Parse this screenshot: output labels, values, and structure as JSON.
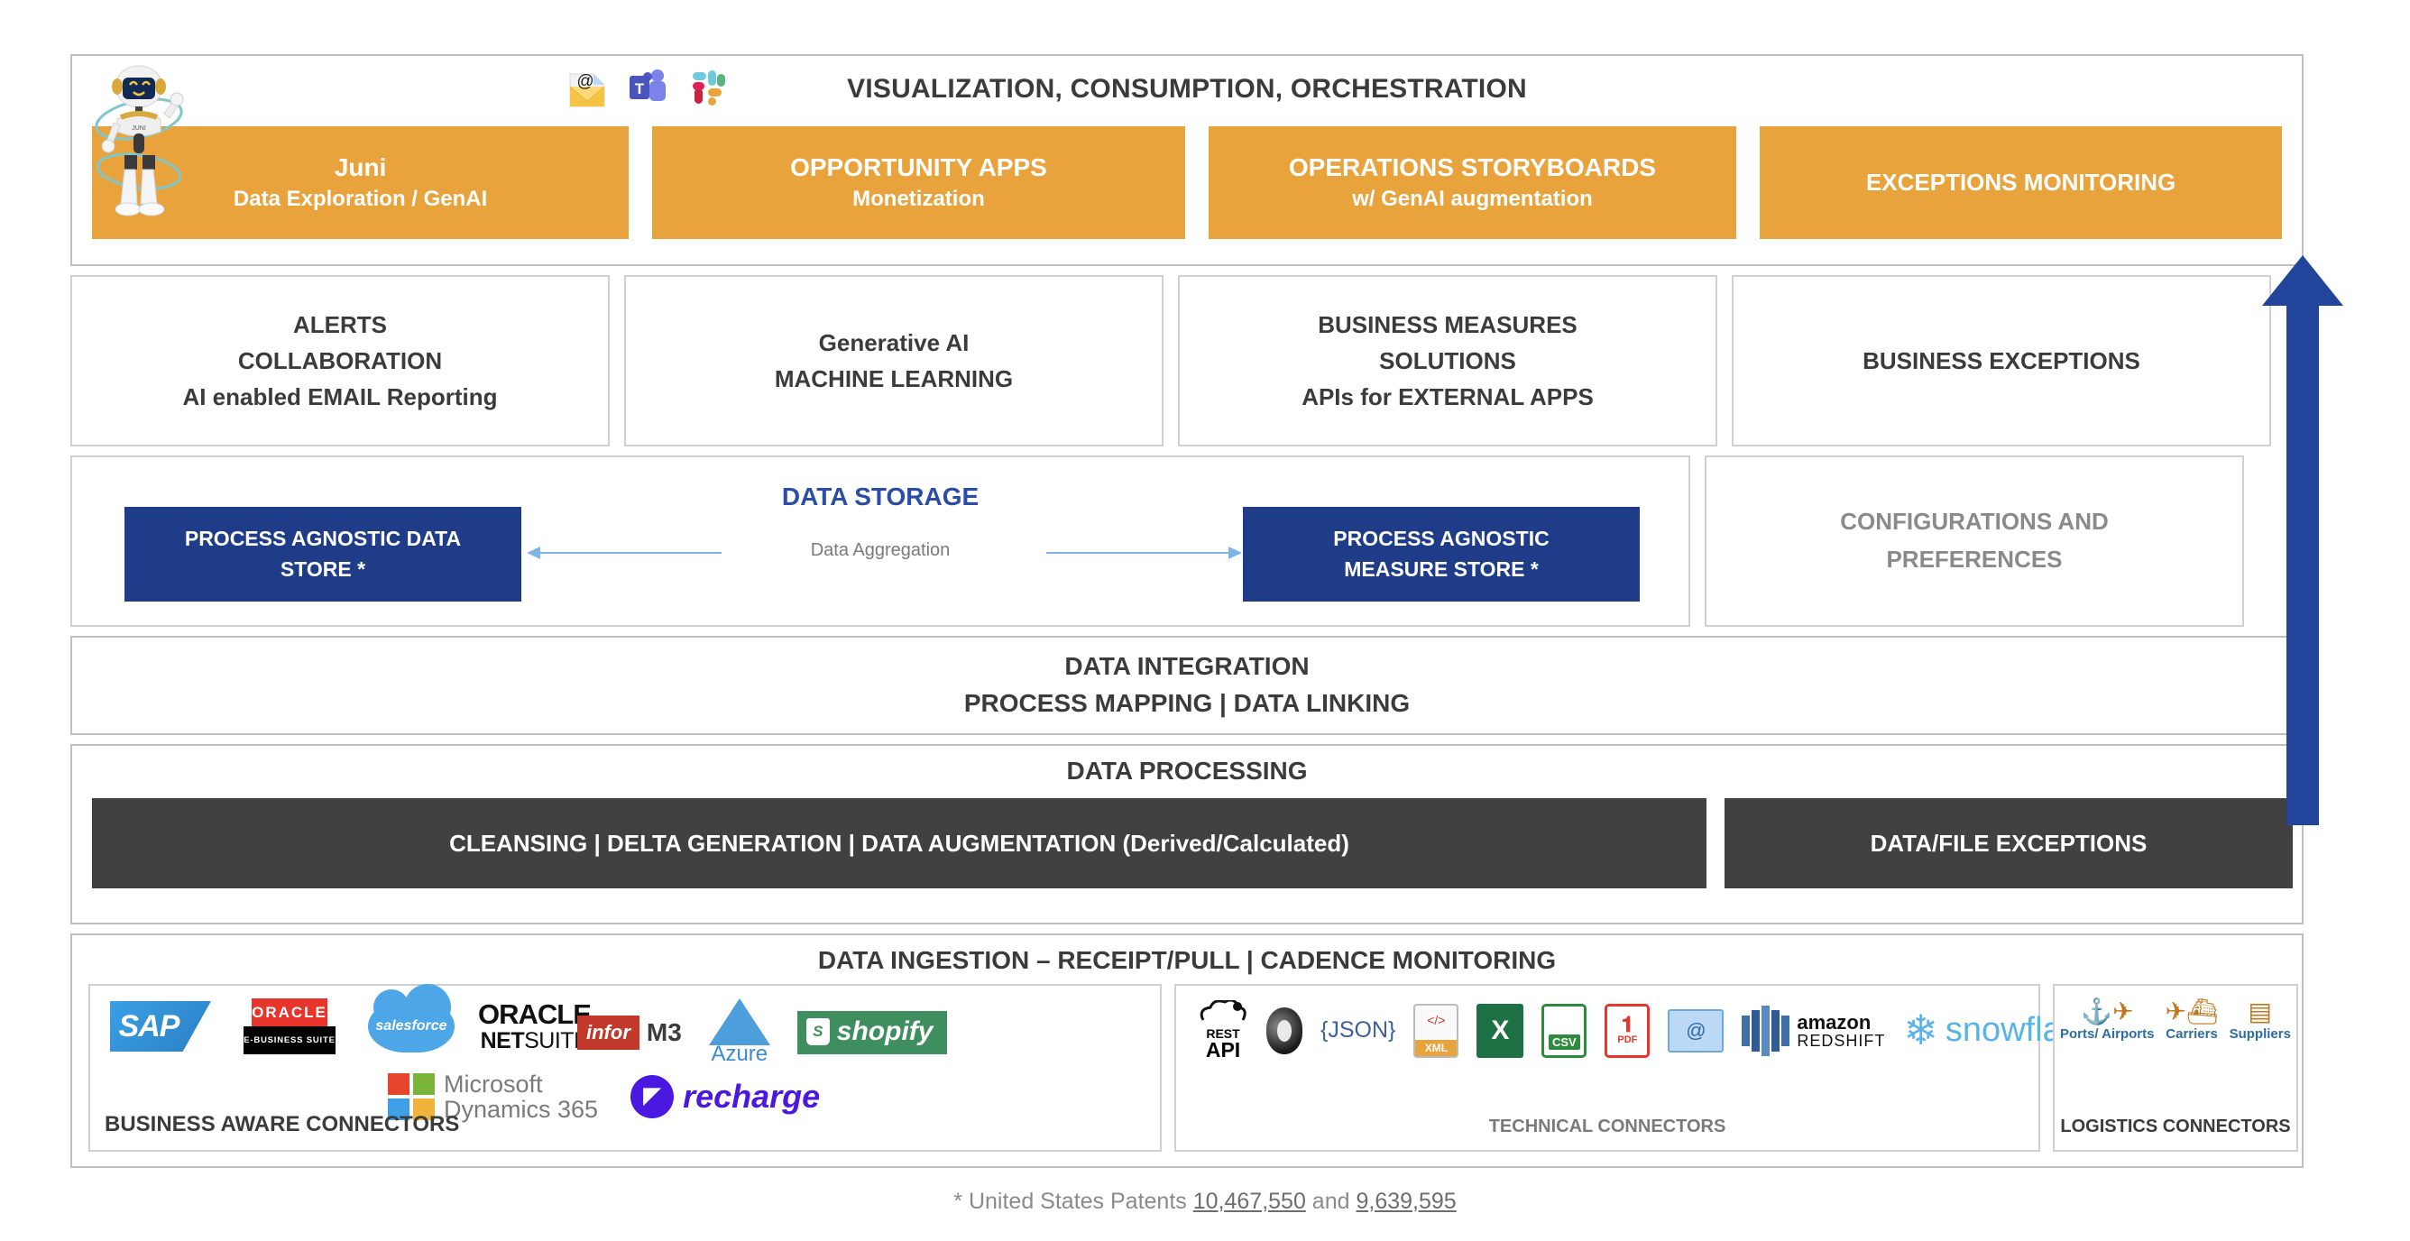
{
  "visualization": {
    "title": "VISUALIZATION, CONSUMPTION, ORCHESTRATION",
    "icons": [
      {
        "name": "email-icon",
        "glyph": "@"
      },
      {
        "name": "microsoft-teams-icon",
        "glyph": "T"
      },
      {
        "name": "slack-icon",
        "glyph": "#"
      }
    ],
    "mascot": {
      "name": "juni-robot-mascot",
      "badge": "JUNI"
    },
    "apps": [
      {
        "line1": "Juni",
        "line2": "Data Exploration / GenAI"
      },
      {
        "line1": "OPPORTUNITY APPS",
        "line2": "Monetization"
      },
      {
        "line1": "OPERATIONS STORYBOARDS",
        "line2": "w/ GenAI augmentation"
      },
      {
        "line1": "EXCEPTIONS MONITORING",
        "line2": ""
      }
    ],
    "accent_color": "#E8A33D"
  },
  "capabilities": [
    {
      "lines": [
        "ALERTS",
        "COLLABORATION",
        "AI enabled EMAIL Reporting"
      ]
    },
    {
      "lines": [
        "Generative AI",
        "MACHINE LEARNING"
      ]
    },
    {
      "lines": [
        "BUSINESS MEASURES",
        "SOLUTIONS",
        "APIs for EXTERNAL APPS"
      ]
    },
    {
      "lines": [
        "BUSINESS EXCEPTIONS"
      ]
    }
  ],
  "storage": {
    "title": "DATA STORAGE",
    "title_color": "#2B4DA8",
    "left_store": [
      "PROCESS AGNOSTIC DATA",
      "STORE *"
    ],
    "right_store": [
      "PROCESS AGNOSTIC",
      "MEASURE STORE *"
    ],
    "aggregation_label": "Data Aggregation",
    "store_color": "#1F3C88",
    "configurations": [
      "CONFIGURATIONS AND",
      "PREFERENCES"
    ]
  },
  "integration": {
    "line1": "DATA INTEGRATION",
    "line2": "PROCESS MAPPING | DATA LINKING"
  },
  "processing": {
    "title": "DATA PROCESSING",
    "main": "CLEANSING | DELTA GENERATION | DATA AUGMENTATION (Derived/Calculated)",
    "exceptions": "DATA/FILE EXCEPTIONS",
    "dark_color": "#414141"
  },
  "ingestion": {
    "title": "DATA INGESTION – RECEIPT/PULL | CADENCE MONITORING",
    "business": {
      "label": "BUSINESS AWARE CONNECTORS",
      "logos": [
        {
          "name": "sap-logo",
          "text": "SAP"
        },
        {
          "name": "oracle-ebusiness-suite-logo",
          "top": "ORACLE",
          "bottom": "E-BUSINESS SUITE"
        },
        {
          "name": "salesforce-logo",
          "text": "salesforce"
        },
        {
          "name": "oracle-netsuite-logo",
          "top": "ORACLE",
          "bottom_bold": "NET",
          "bottom_rest": "SUITE"
        },
        {
          "name": "infor-m3-logo",
          "brand": "infor",
          "suffix": "M3"
        },
        {
          "name": "microsoft-azure-logo",
          "text": "Azure"
        },
        {
          "name": "shopify-logo",
          "text": "shopify",
          "mark": "S"
        },
        {
          "name": "microsoft-dynamics-365-logo",
          "line1": "Microsoft",
          "line2": "Dynamics 365"
        },
        {
          "name": "recharge-logo",
          "text": "recharge"
        }
      ]
    },
    "technical": {
      "label": "TECHNICAL CONNECTORS",
      "logos": [
        {
          "name": "rest-api-icon",
          "line1": "REST",
          "line2": "API"
        },
        {
          "name": "mongodb-icon",
          "text": ""
        },
        {
          "name": "json-icon",
          "text": "{JSON}"
        },
        {
          "name": "xml-file-icon",
          "text": "XML",
          "code": "</>"
        },
        {
          "name": "excel-file-icon",
          "text": "X"
        },
        {
          "name": "csv-file-icon",
          "text": "CSV"
        },
        {
          "name": "pdf-file-icon",
          "text": "PDF"
        },
        {
          "name": "email-file-icon",
          "text": "@"
        },
        {
          "name": "amazon-redshift-logo",
          "line1": "amazon",
          "line2": "REDSHIFT"
        },
        {
          "name": "snowflake-logo",
          "text": "snowflake"
        }
      ]
    },
    "logistics": {
      "label": "LOGISTICS CONNECTORS",
      "items": [
        {
          "name": "ports-airports-icon",
          "label": "Ports/ Airports",
          "glyph": "⚓✈"
        },
        {
          "name": "carriers-icon",
          "label": "Carriers",
          "glyph": "✈⛴"
        },
        {
          "name": "suppliers-icon",
          "label": "Suppliers",
          "glyph": "▤"
        }
      ]
    }
  },
  "arrow": {
    "name": "exceptions-flow-arrow",
    "color": "#22459B"
  },
  "footer": {
    "prefix": "* United States Patents ",
    "patent1": "10,467,550",
    "middle": " and ",
    "patent2": "9,639,595"
  }
}
